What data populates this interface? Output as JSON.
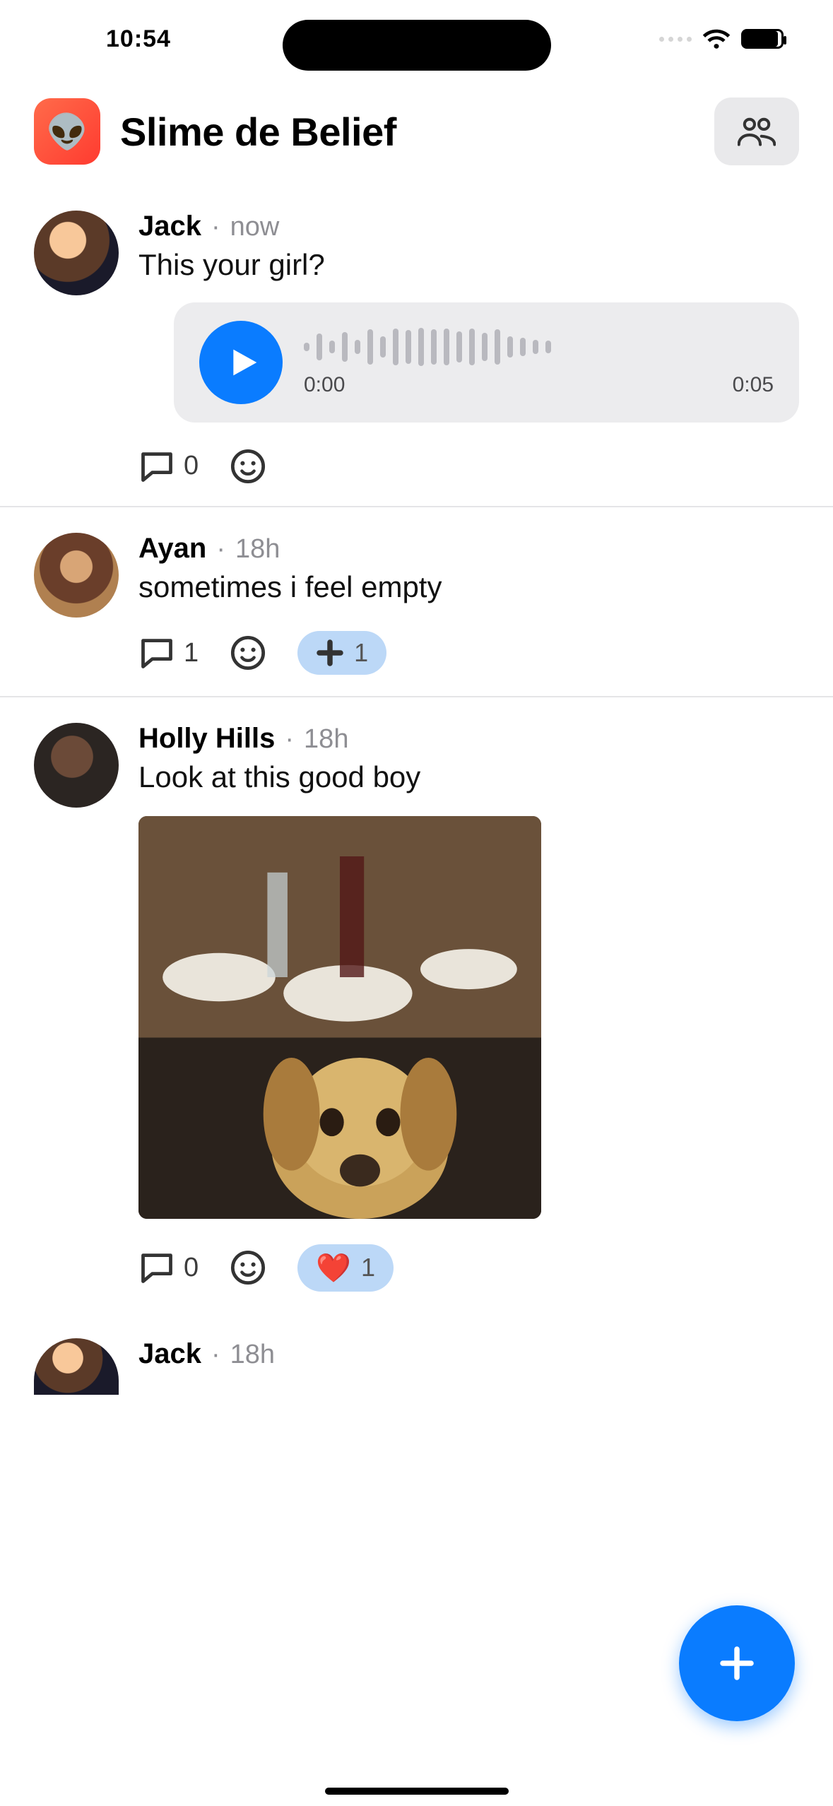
{
  "status": {
    "time": "10:54"
  },
  "header": {
    "group_emoji": "👽",
    "group_name": "Slime de Belief"
  },
  "posts": [
    {
      "author": "Jack",
      "time": "now",
      "text": "This your girl?",
      "voice": {
        "current": "0:00",
        "duration": "0:05"
      },
      "comments": "0"
    },
    {
      "author": "Ayan",
      "time": "18h",
      "text": "sometimes i feel empty",
      "comments": "1",
      "plus_count": "1"
    },
    {
      "author": "Holly Hills",
      "time": "18h",
      "text": "Look at this good boy",
      "comments": "0",
      "heart_count": "1"
    },
    {
      "author": "Jack",
      "time": "18h"
    }
  ]
}
